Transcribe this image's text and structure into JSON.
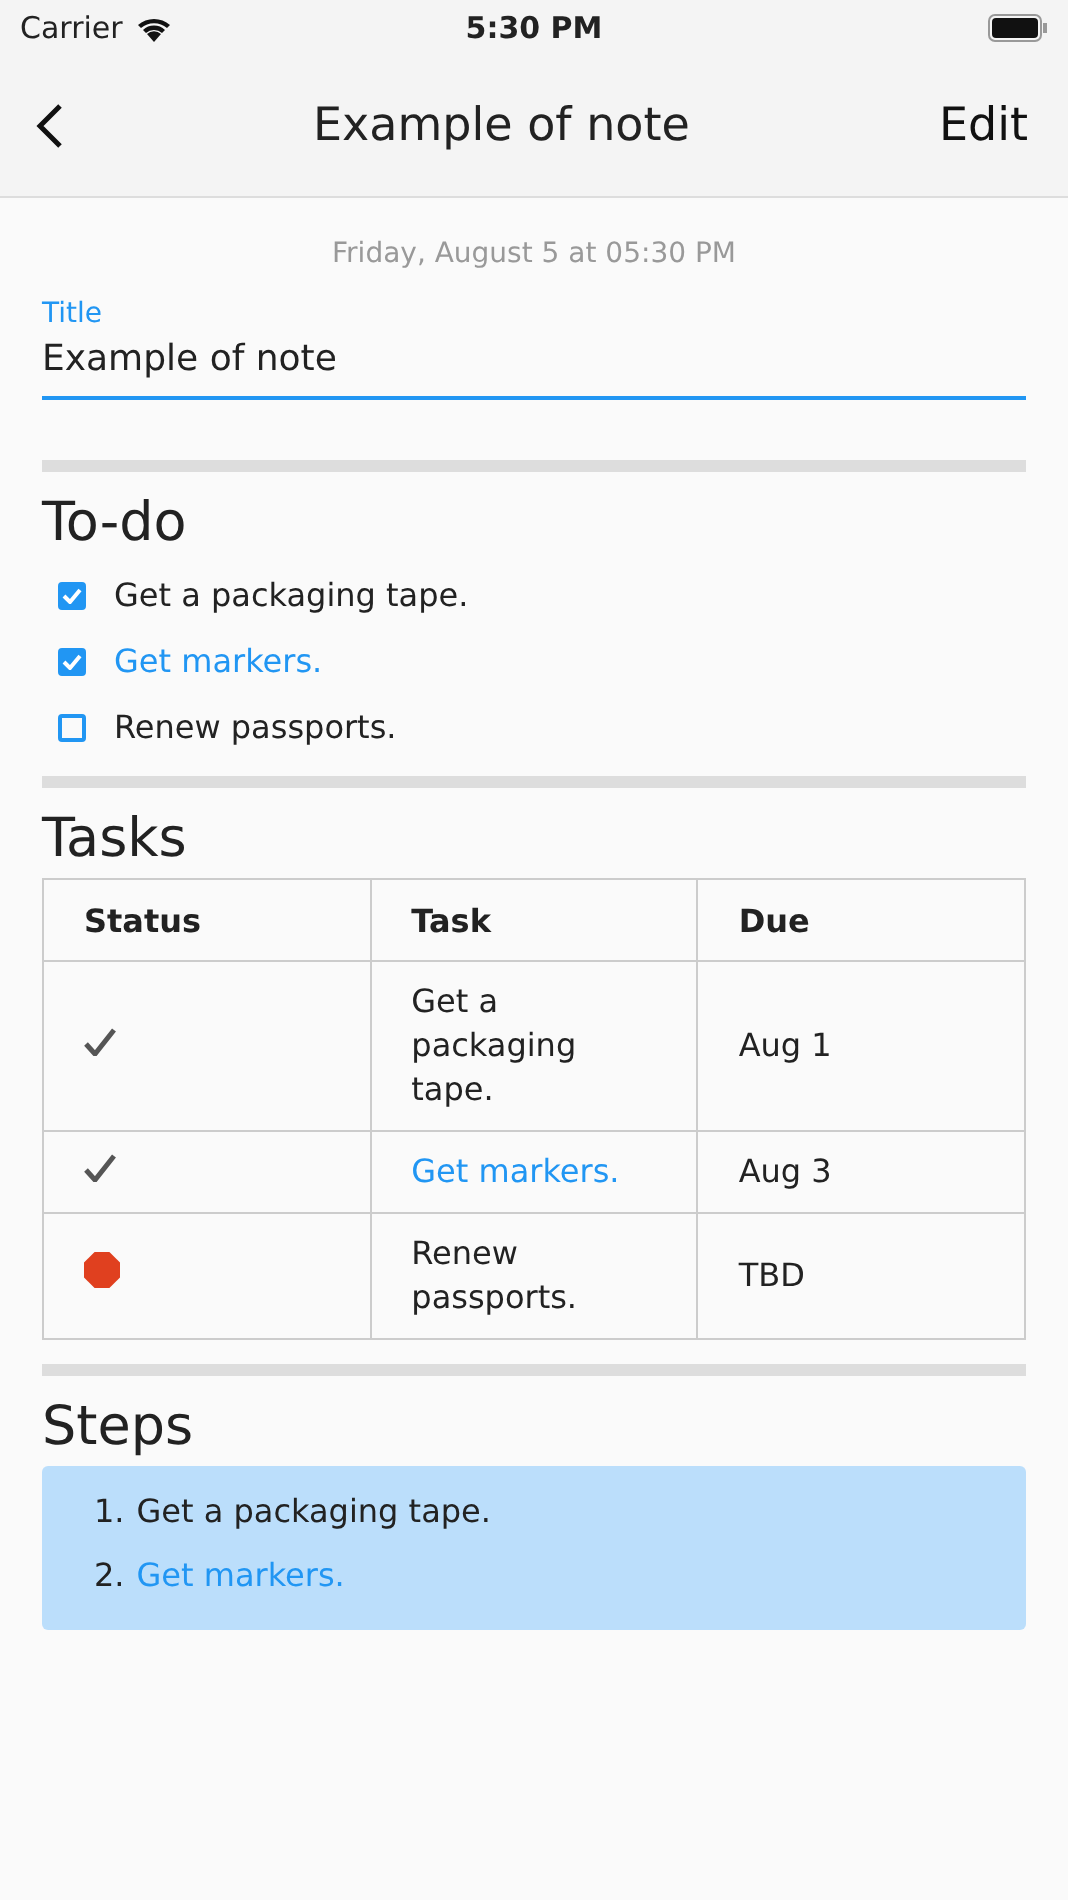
{
  "status_bar": {
    "carrier": "Carrier",
    "time": "5:30 PM"
  },
  "nav": {
    "title": "Example of note",
    "action": "Edit"
  },
  "date": "Friday, August 5 at 05:30 PM",
  "title_field": {
    "label": "Title",
    "value": "Example of note"
  },
  "todo": {
    "heading": "To-do",
    "items": [
      {
        "text": "Get a packaging tape.",
        "checked": true,
        "link": false
      },
      {
        "text": "Get markers.",
        "checked": true,
        "link": true
      },
      {
        "text": "Renew passports.",
        "checked": false,
        "link": false
      }
    ]
  },
  "tasks": {
    "heading": "Tasks",
    "columns": [
      "Status",
      "Task",
      "Due"
    ],
    "rows": [
      {
        "kind": "done",
        "task": "Get a packaging tape.",
        "link": false,
        "due": "Aug 1"
      },
      {
        "kind": "done",
        "task": "Get markers.",
        "link": true,
        "due": "Aug 3"
      },
      {
        "kind": "stopped",
        "task": "Renew passports.",
        "link": false,
        "due": "TBD"
      }
    ]
  },
  "steps": {
    "heading": "Steps",
    "items": [
      {
        "number": "1.",
        "text": "Get a packaging tape.",
        "link": false
      },
      {
        "number": "2.",
        "text": "Get markers.",
        "link": true
      }
    ]
  }
}
